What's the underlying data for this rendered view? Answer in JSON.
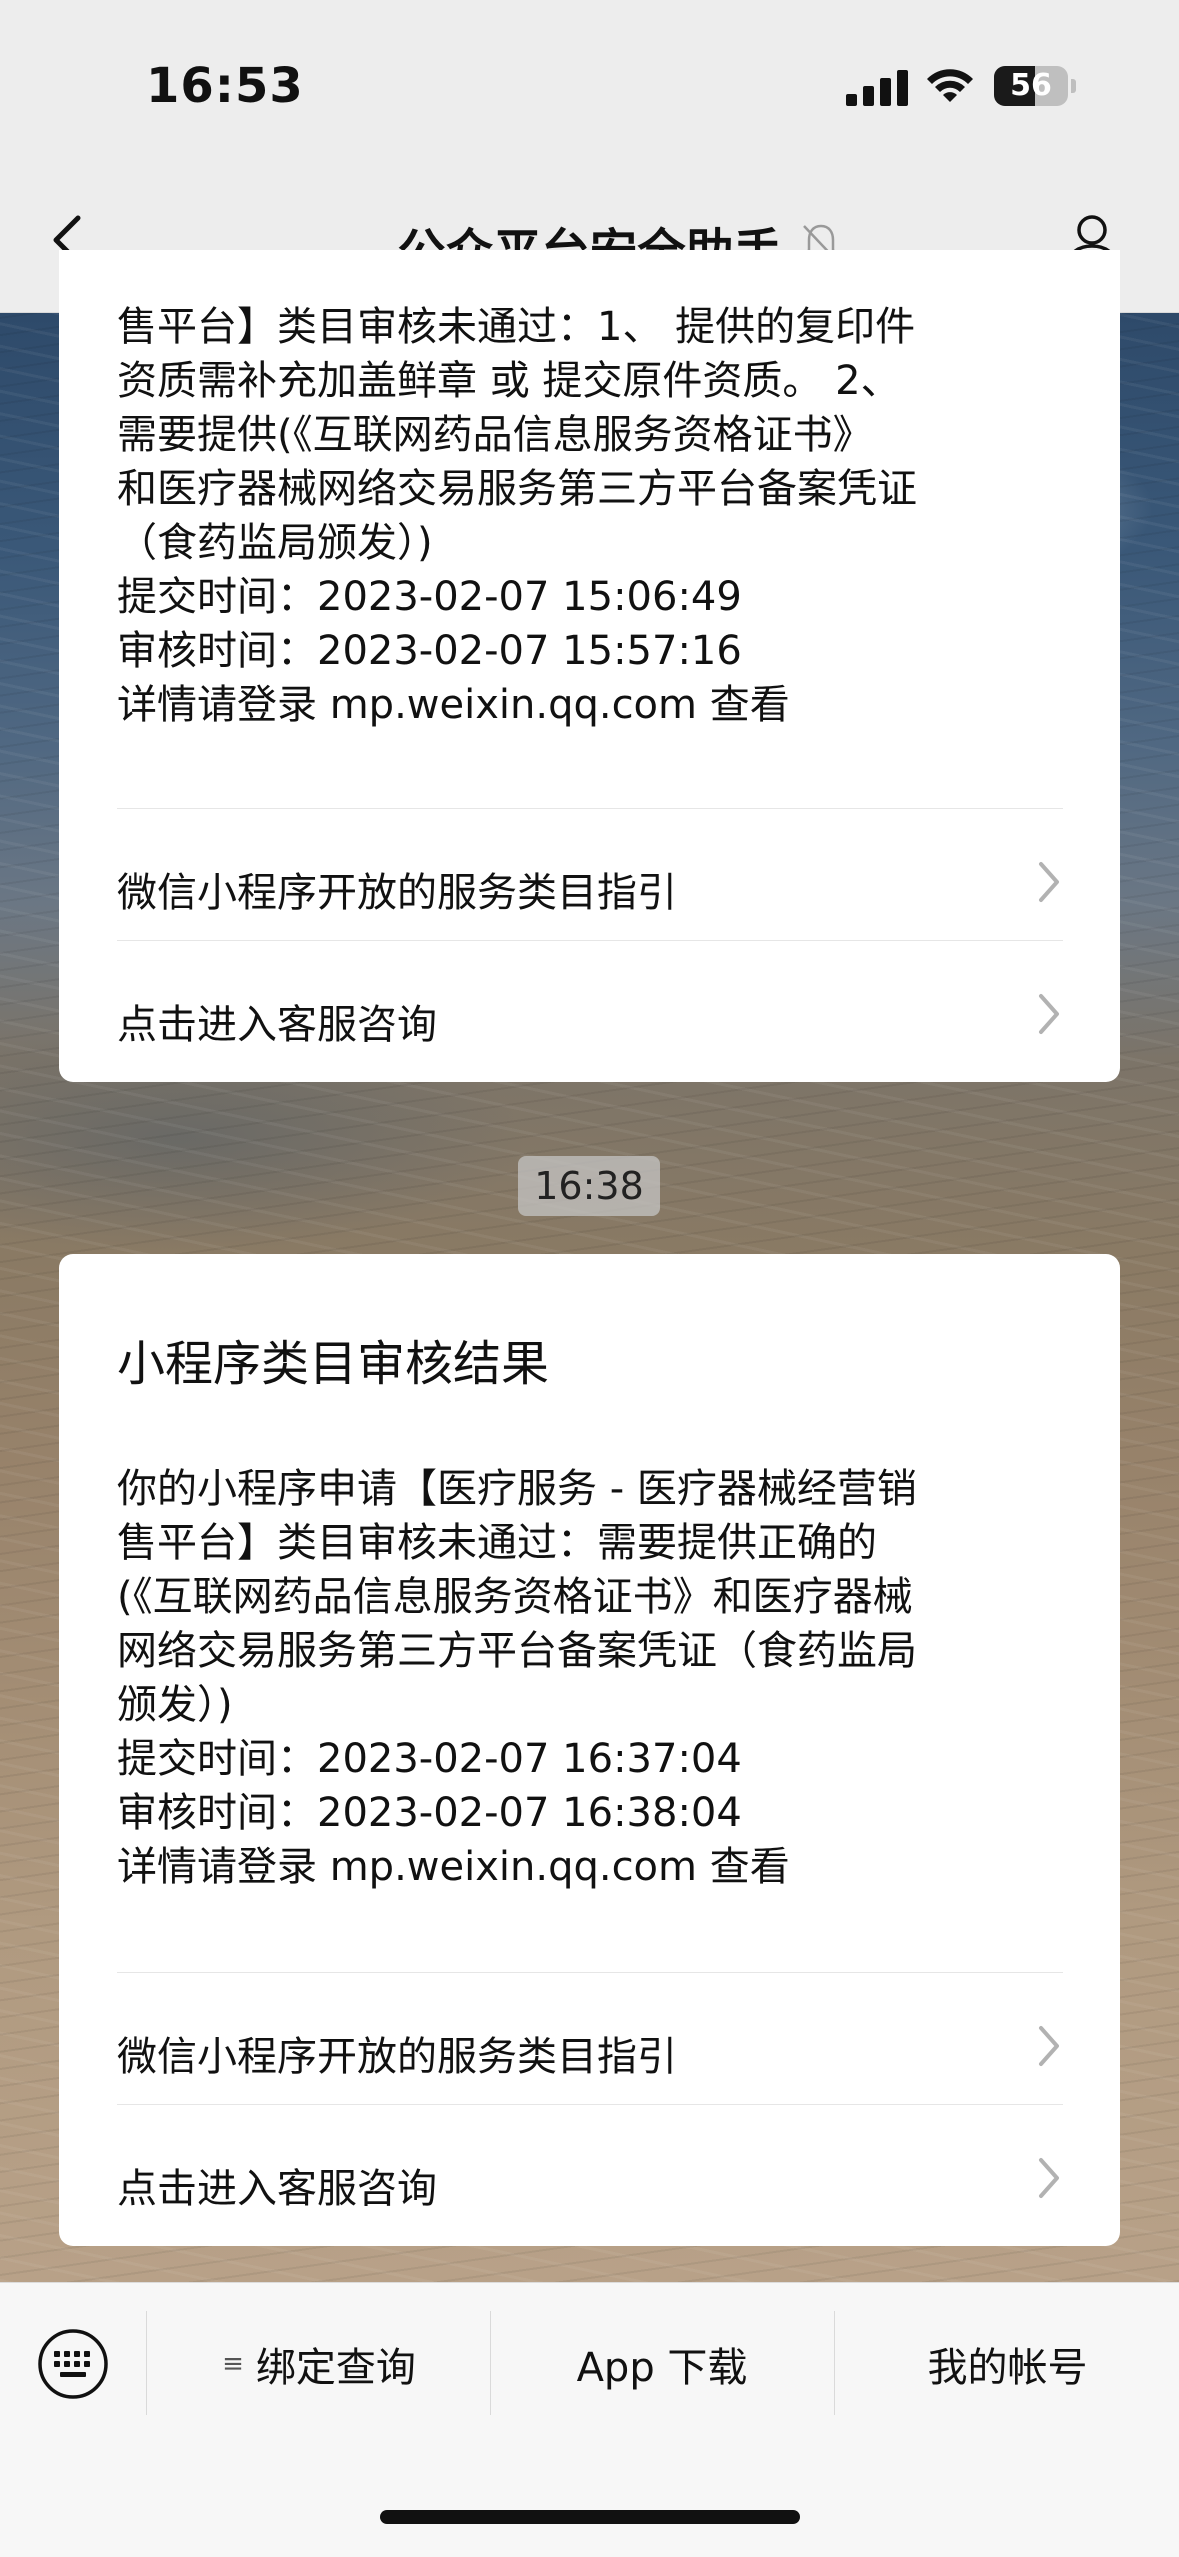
{
  "status_bar": {
    "time": "16:53",
    "battery": "56",
    "battery_level": 0.56
  },
  "nav": {
    "title": "公众平台安全助手"
  },
  "messages": [
    {
      "body": "售平台】类目审核未通过：1、 提供的复印件\n资质需补充加盖鲜章 或 提交原件资质。 2、\n需要提供(《互联网药品信息服务资格证书》\n和医疗器械网络交易服务第三方平台备案凭证\n（食药监局颁发）)\n提交时间：2023-02-07 15:06:49\n审核时间：2023-02-07 15:57:16\n详情请登录 mp.weixin.qq.com 查看",
      "links": [
        "微信小程序开放的服务类目指引",
        "点击进入客服咨询"
      ]
    },
    {
      "timestamp": "16:38",
      "title": "小程序类目审核结果",
      "body": "你的小程序申请【医疗服务 - 医疗器械经营销\n售平台】类目审核未通过：需要提供正确的\n(《互联网药品信息服务资格证书》和医疗器械\n网络交易服务第三方平台备案凭证（食药监局\n颁发）)\n提交时间：2023-02-07 16:37:04\n审核时间：2023-02-07 16:38:04\n详情请登录 mp.weixin.qq.com 查看",
      "links": [
        "微信小程序开放的服务类目指引",
        "点击进入客服咨询"
      ]
    }
  ],
  "bottom_menu": [
    "绑定查询",
    "App 下载",
    "我的帐号"
  ],
  "icons": [
    "back-icon",
    "mute-icon",
    "profile-icon",
    "chevron-right-icon",
    "keyboard-icon",
    "menu-lines-icon"
  ]
}
